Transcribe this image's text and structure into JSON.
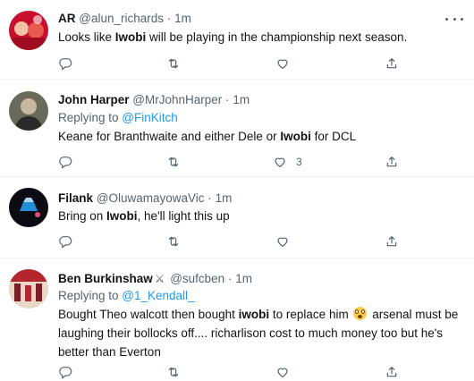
{
  "tweets": [
    {
      "display_name": "AR",
      "handle": "@alun_richards",
      "dot": "·",
      "time": "1m",
      "reply_prefix": "",
      "reply_handle": "",
      "text_parts": [
        "Looks like ",
        "Iwobi",
        " will be playing in the championship next season."
      ],
      "like_count": "",
      "avatar_colors": [
        "#c8102e",
        "#e85a4f",
        "#f2c1a5"
      ]
    },
    {
      "display_name": "John Harper",
      "handle": "@MrJohnHarper",
      "dot": "·",
      "time": "1m",
      "reply_prefix": "Replying to ",
      "reply_handle": "@FinKitch",
      "text_parts": [
        "Keane for Branthwaite and either Dele or ",
        "Iwobi",
        " for DCL"
      ],
      "like_count": "3",
      "avatar_colors": [
        "#2b2b2b",
        "#6a6a5a",
        "#c9b9a0"
      ]
    },
    {
      "display_name": "Filank",
      "handle": "@OluwamayowaVic",
      "dot": "·",
      "time": "1m",
      "reply_prefix": "",
      "reply_handle": "",
      "text_parts": [
        "Bring on ",
        "Iwobi",
        ", he'll light this up"
      ],
      "like_count": "",
      "avatar_colors": [
        "#0b0b14",
        "#1f8fd6",
        "#a9d8f0"
      ]
    },
    {
      "display_name": "Ben Burkinshaw",
      "handle": "@sufcben",
      "dot": "·",
      "time": "1m",
      "reply_prefix": "Replying to ",
      "reply_handle": "@1_Kendall_",
      "text_parts": [
        "Bought Theo walcott then bought ",
        "iwobi",
        " to replace him ",
        "",
        " arsenal must be laughing their bollocks off.... richarlison cost to much money too but he's better than Everton"
      ],
      "like_count": "",
      "avatar_colors": [
        "#b3262e",
        "#e8d8c8",
        "#7a1f24"
      ]
    }
  ],
  "colors": {
    "text": "#0f1419",
    "secondary": "#536471",
    "link": "#1d9bf0",
    "divider": "#eff3f4"
  },
  "icons": [
    "reply-icon",
    "retweet-icon",
    "like-icon",
    "share-icon",
    "more-icon",
    "flushed-face-emoji",
    "crossed-swords-emoji"
  ]
}
